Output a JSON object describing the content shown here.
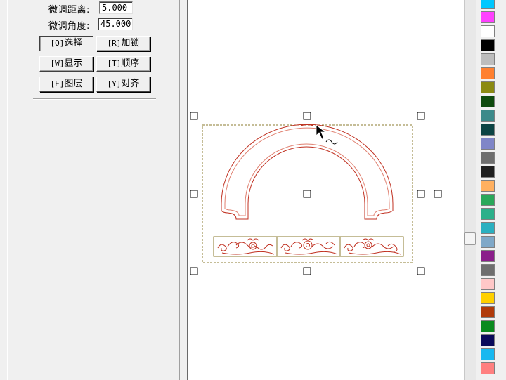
{
  "panel": {
    "nudge_distance_label": "微调距离:",
    "nudge_distance_value": "5.000",
    "nudge_angle_label": "微调角度:",
    "nudge_angle_value": "45.000",
    "buttons": [
      {
        "key": "[Q]",
        "label": "选择"
      },
      {
        "key": "[R]",
        "label": "加锁"
      },
      {
        "key": "[W]",
        "label": "显示"
      },
      {
        "key": "[T]",
        "label": "顺序"
      },
      {
        "key": "[E]",
        "label": "图层"
      },
      {
        "key": "[Y]",
        "label": "对齐"
      }
    ]
  },
  "colors": {
    "selection_box": "#8b7b2f",
    "design_stroke": "#c03020",
    "design_stroke_light": "#e08070"
  },
  "palette": [
    "#00c8ff",
    "#ff40ff",
    "#ffffff",
    "#000000",
    "#bdbdbd",
    "#ff8030",
    "#8b8a12",
    "#0e4a0e",
    "#3c8a8a",
    "#0c4444",
    "#7f86c8",
    "#6e6e6e",
    "#1e1e1e",
    "#ffb060",
    "#2aa85a",
    "#2cb08a",
    "#2ab0c0",
    "#7fa8c8",
    "#8a1e8a",
    "#6e6e6e",
    "#ffc8c8",
    "#ffd000",
    "#b03a0a",
    "#0a8a1e",
    "#0a0a5a",
    "#18b8f0",
    "#ff8080"
  ]
}
